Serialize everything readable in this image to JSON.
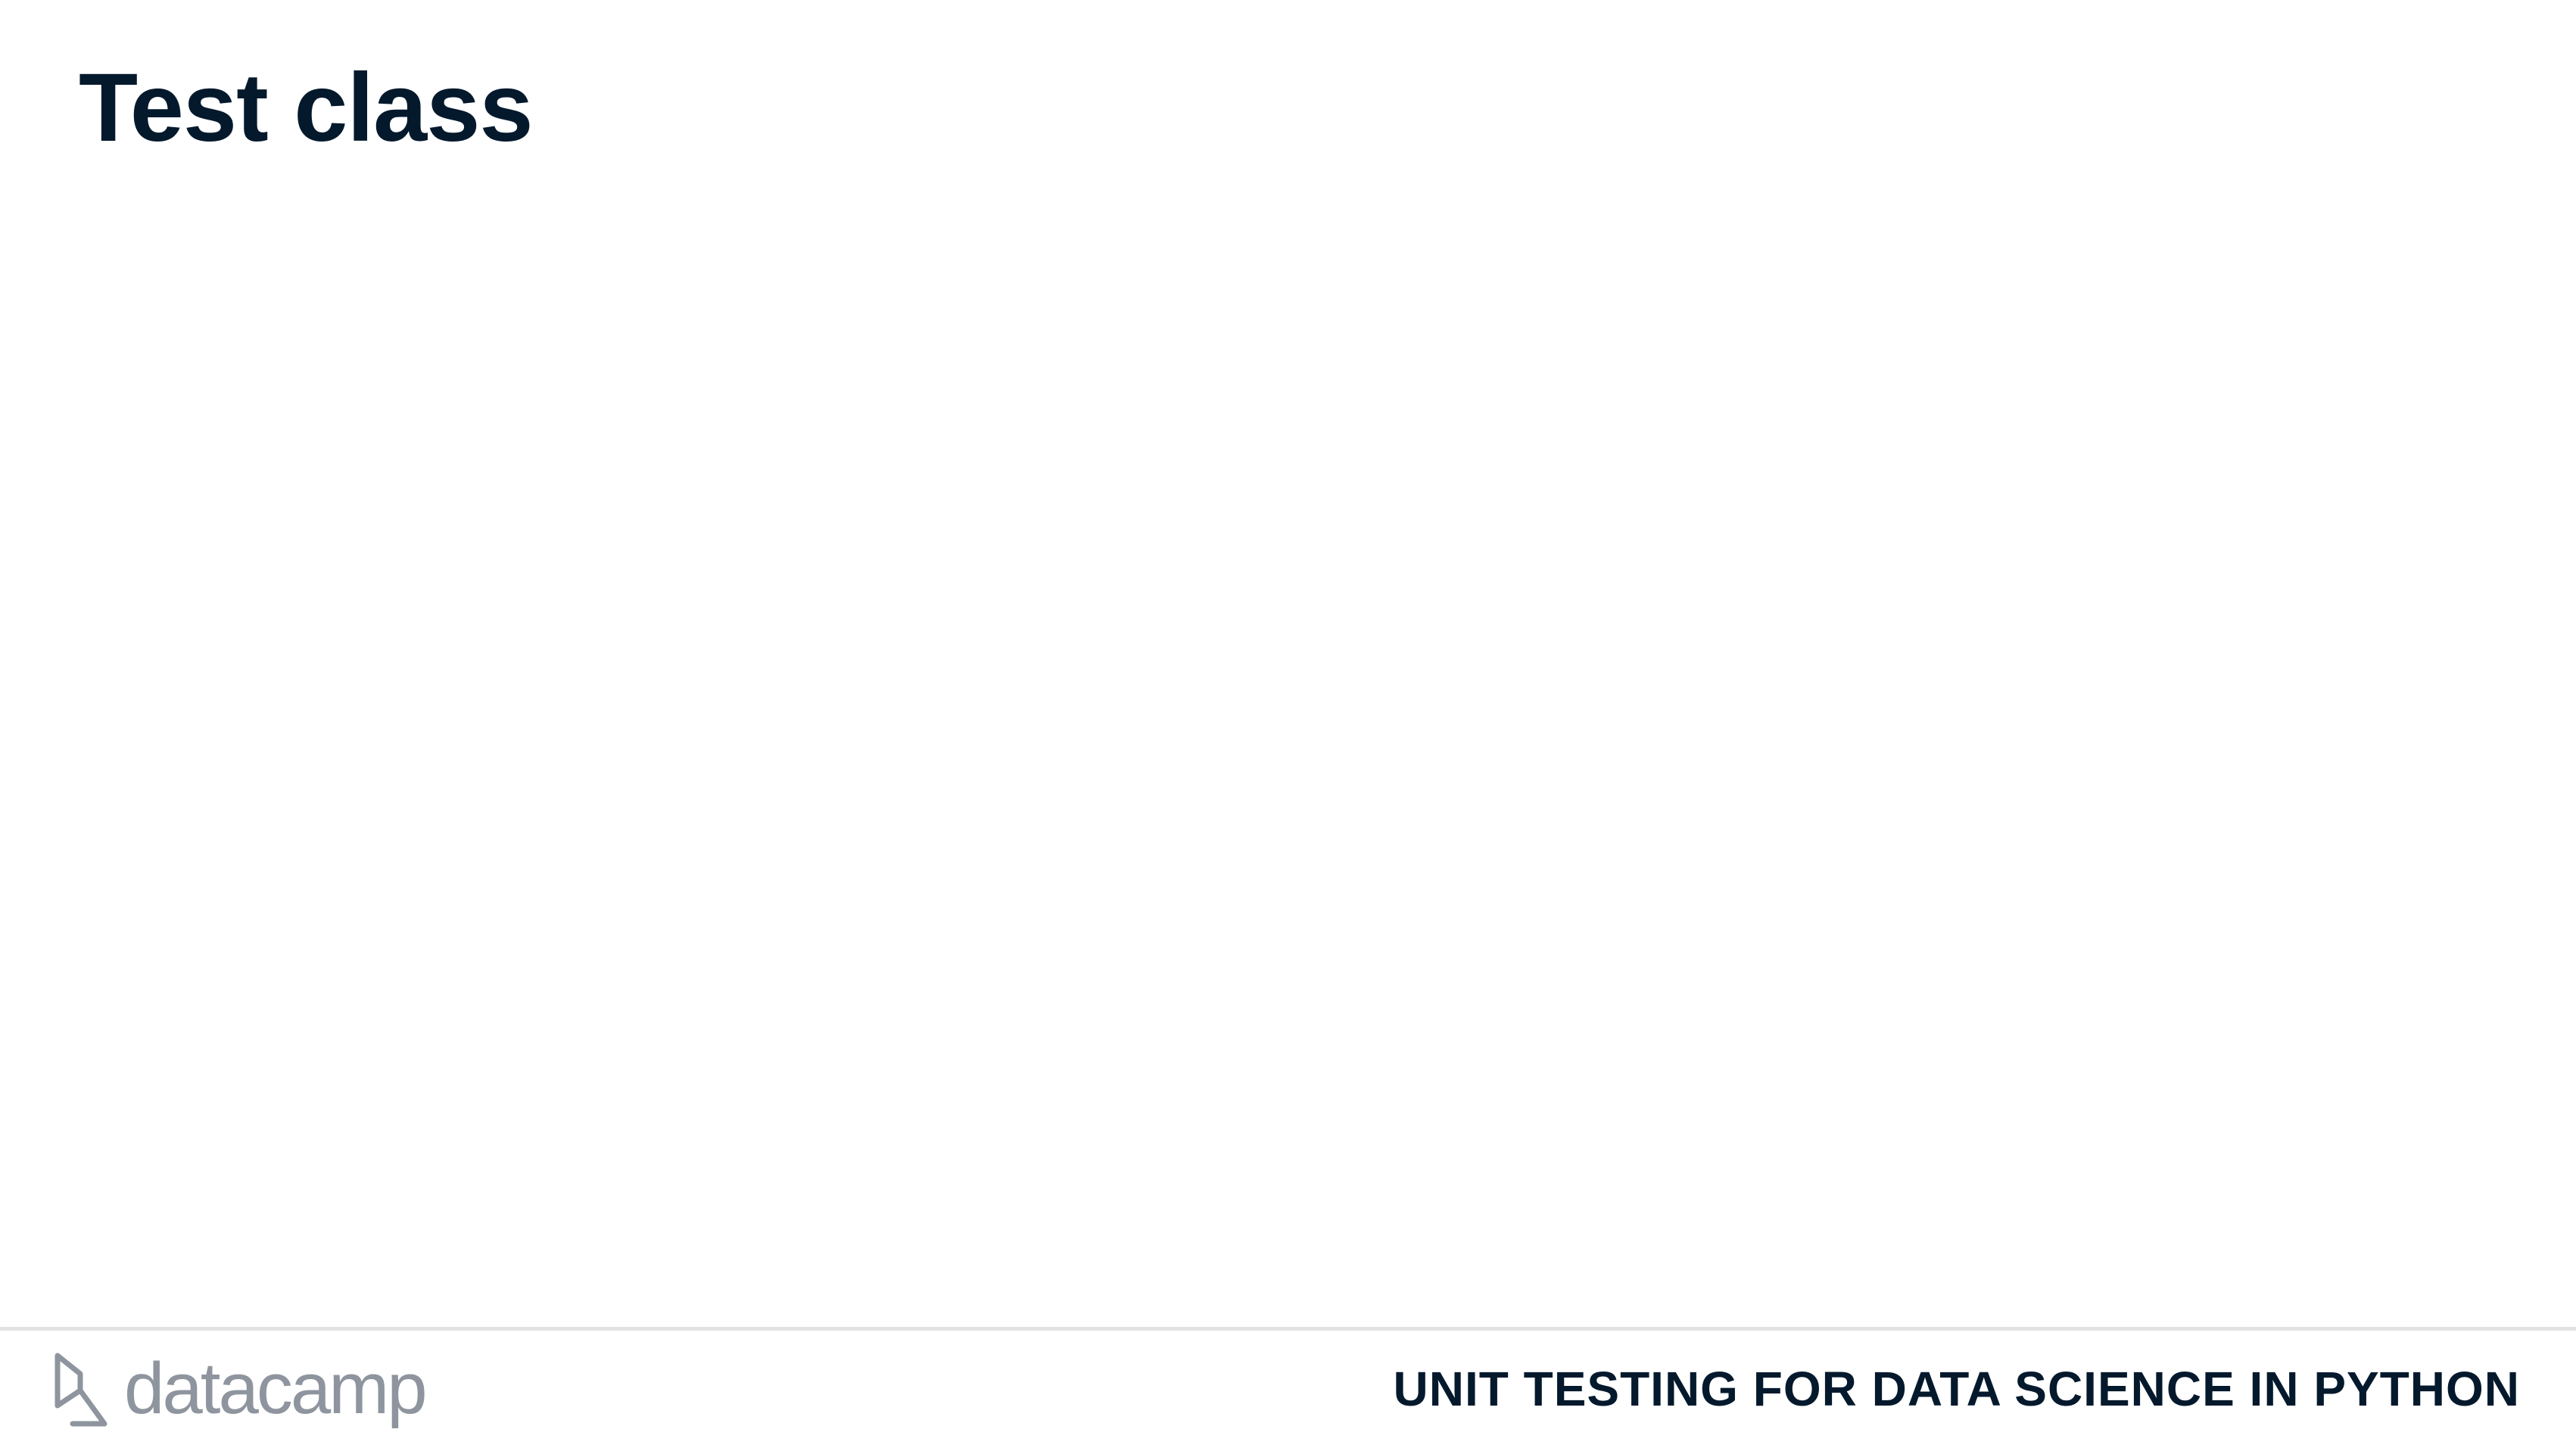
{
  "slide": {
    "title": "Test class"
  },
  "footer": {
    "logo_text": "datacamp",
    "logo_icon": "datacamp-logo-icon",
    "course_name": "UNIT TESTING FOR DATA SCIENCE IN PYTHON"
  },
  "colors": {
    "title": "#05192d",
    "logo": "#8e959e",
    "divider": "#e1e3e5",
    "background": "#ffffff"
  }
}
